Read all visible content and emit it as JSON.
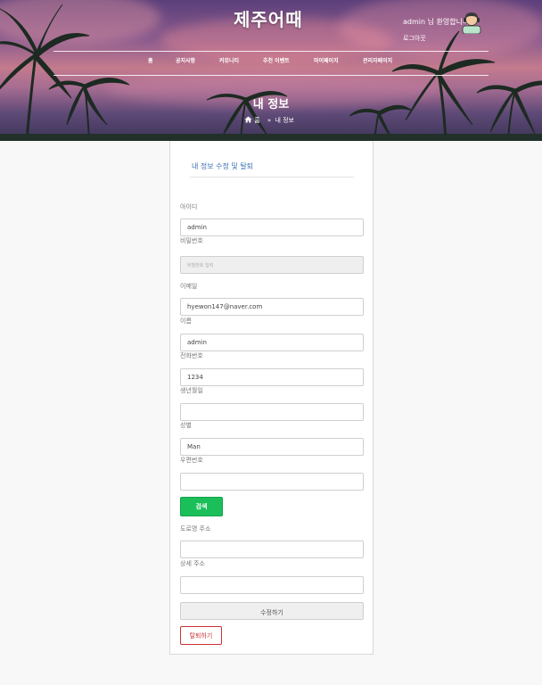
{
  "header": {
    "logo": "제주어때",
    "welcome": "admin 님 환영합니다",
    "logout": "로그아웃",
    "nav": [
      "홈",
      "공지사항",
      "커뮤니티",
      "추천 이벤트",
      "마이페이지",
      "관리자페이지"
    ],
    "page_heading": "내 정보",
    "breadcrumb": {
      "home": "홈",
      "separator": "»",
      "current": "내 정보"
    }
  },
  "form": {
    "title": "내 정보 수정 및 탈퇴",
    "id": {
      "label": "아이디",
      "value": "admin"
    },
    "password": {
      "label": "비밀번호",
      "placeholder": "비밀번호 입력"
    },
    "email": {
      "label": "이메일",
      "value": "hyewon147@naver.com"
    },
    "name": {
      "label": "이름",
      "value": "admin"
    },
    "phone": {
      "label": "전화번호",
      "value": "1234"
    },
    "birth": {
      "label": "생년월일",
      "value": ""
    },
    "gender": {
      "label": "성별",
      "value": "Man"
    },
    "postcode": {
      "label": "우편번호",
      "value": ""
    },
    "search_button": "검색",
    "road_address": {
      "label": "도로명 주소",
      "value": ""
    },
    "detail_address": {
      "label": "상세 주소",
      "value": ""
    },
    "submit_button": "수정하기",
    "withdraw_button": "탈퇴하기"
  },
  "colors": {
    "accent_green": "#1bbf5a",
    "danger_red": "#cc3333",
    "title_blue": "#3b6fb0"
  }
}
